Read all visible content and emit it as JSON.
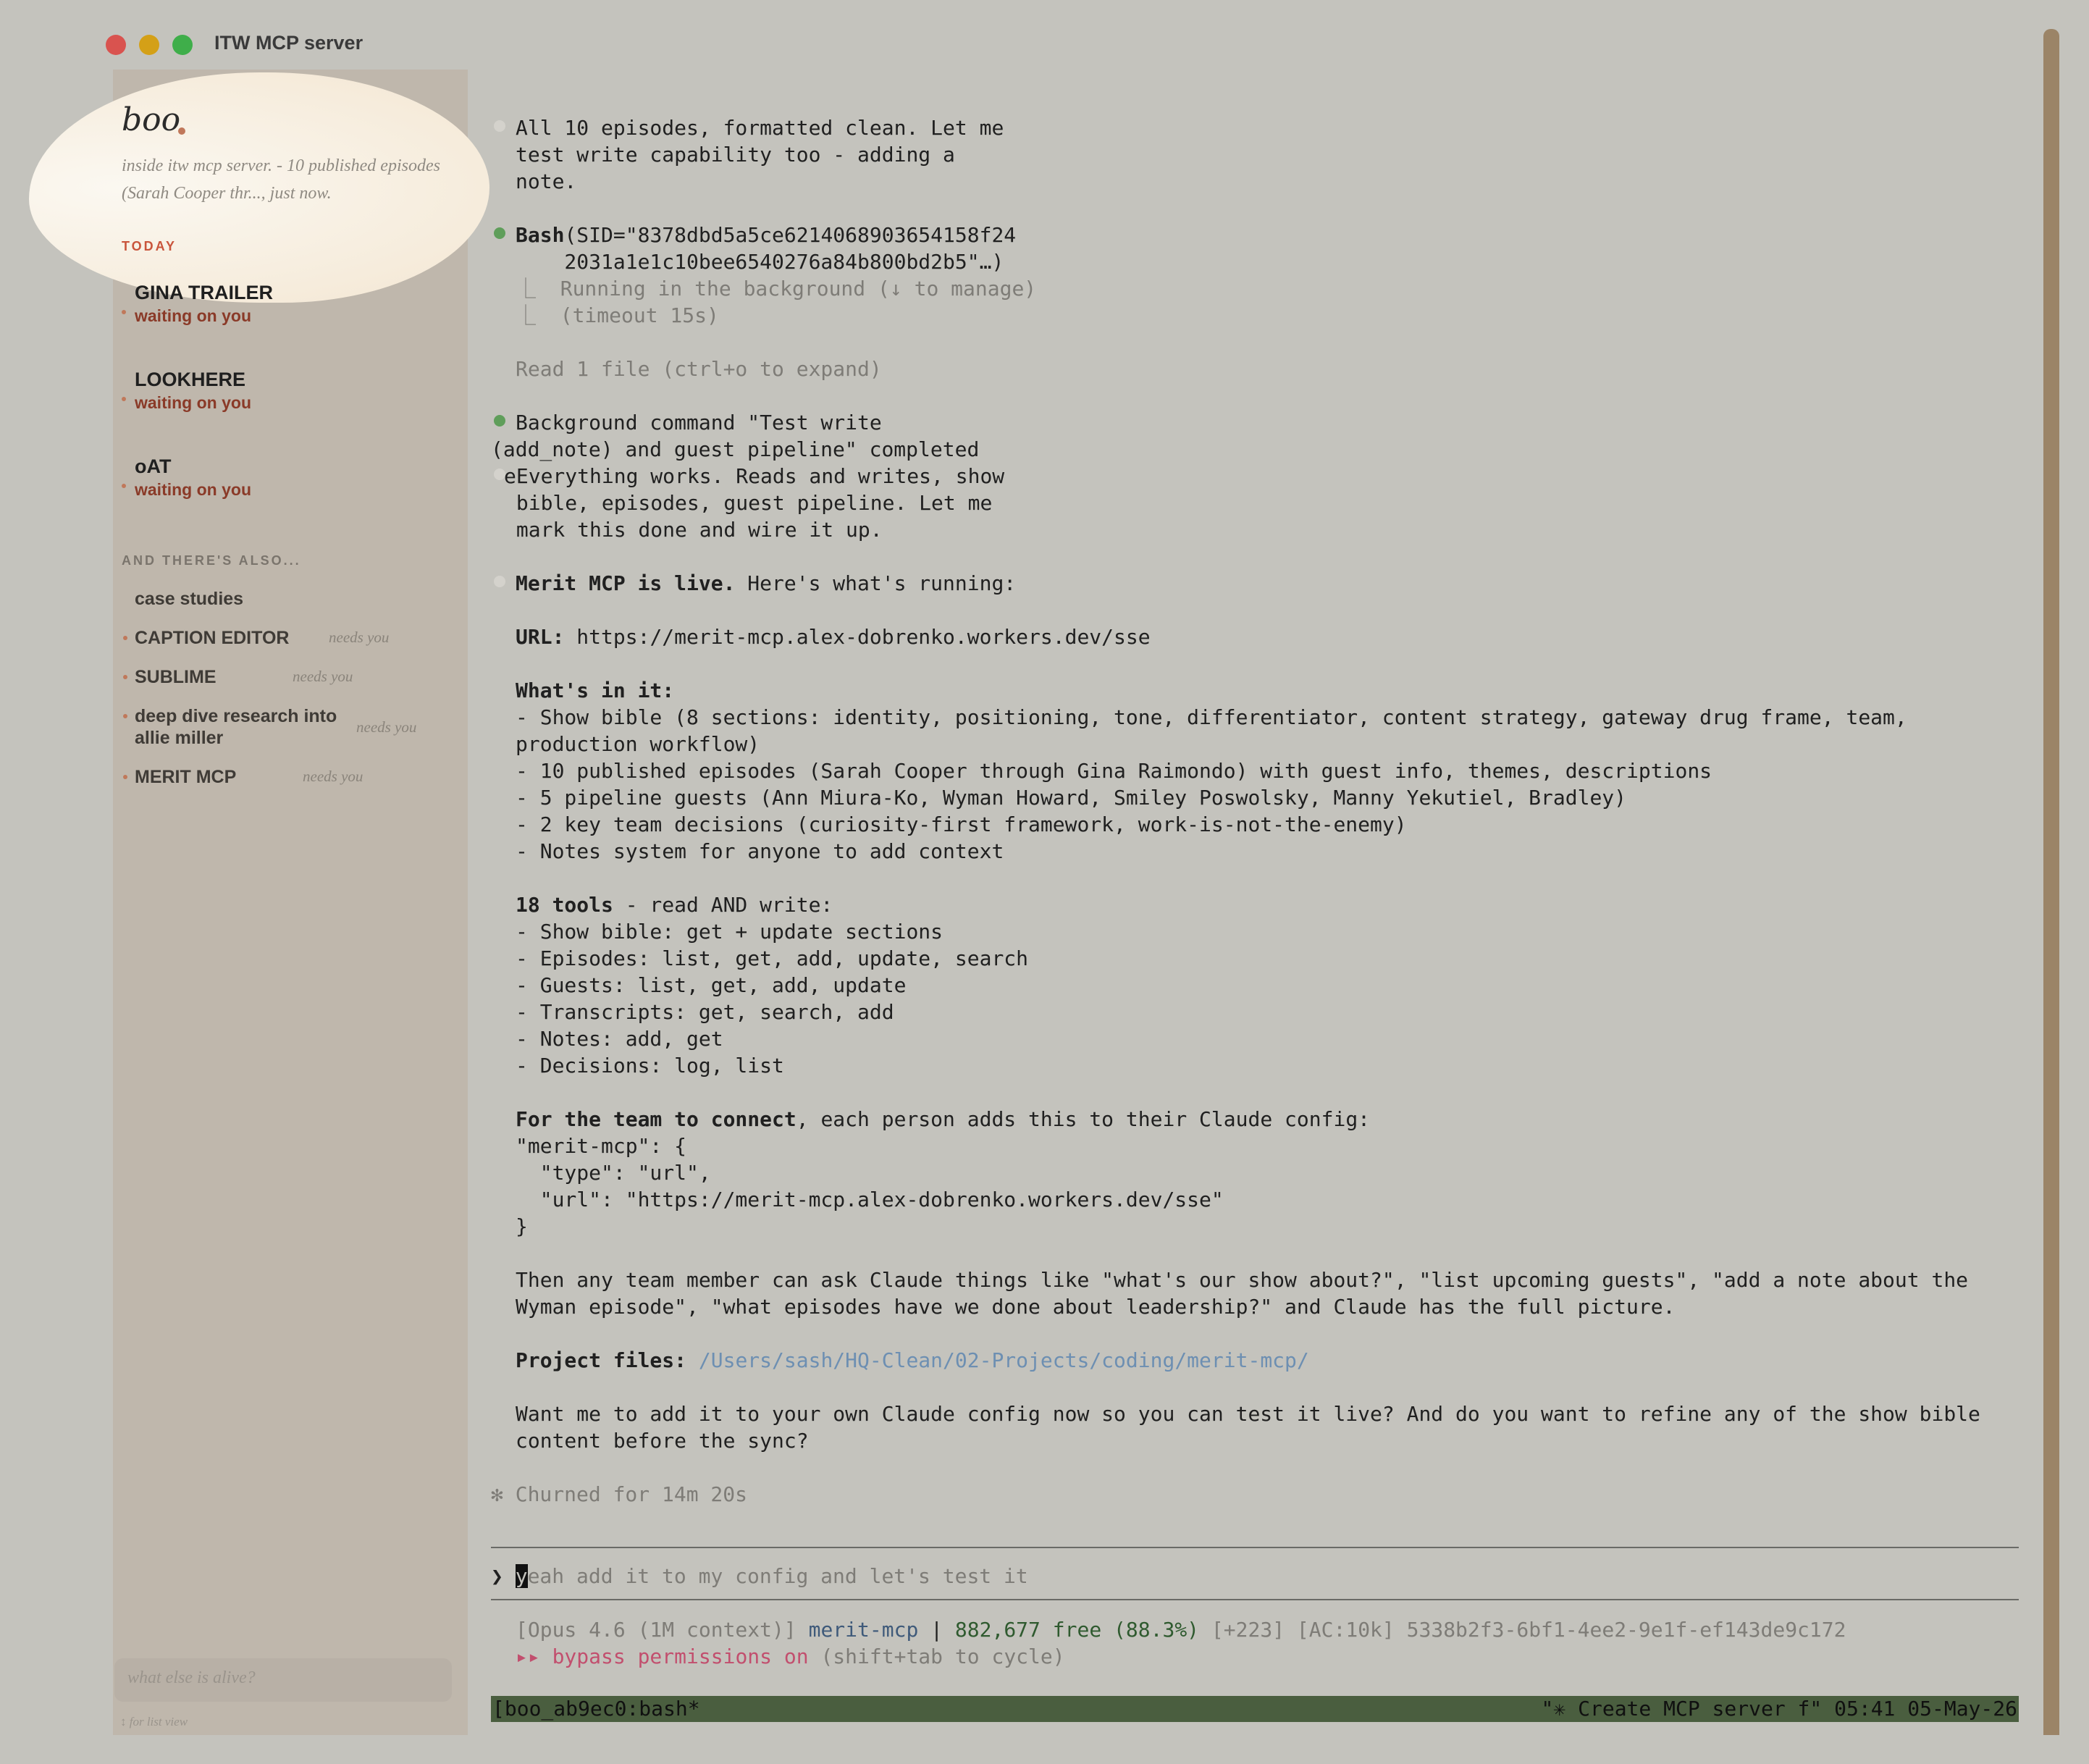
{
  "window": {
    "title": "ITW MCP server"
  },
  "sidebar": {
    "hero": {
      "title": "boo",
      "subtitle": "inside itw mcp server. - 10 published episodes (Sarah Cooper thr..., just now."
    },
    "today_label": "TODAY",
    "today": [
      {
        "name": "GINA TRAILER",
        "status": "waiting on you"
      },
      {
        "name": "LOOKHERE",
        "status": "waiting on you"
      },
      {
        "name": "oAT",
        "status": "waiting on you"
      }
    ],
    "also_label": "AND THERE'S ALSO...",
    "also": [
      {
        "name": "case studies",
        "needs": ""
      },
      {
        "name": "CAPTION EDITOR",
        "needs": "needs you"
      },
      {
        "name": "SUBLIME",
        "needs": "needs you"
      },
      {
        "name": "deep dive research into",
        "name2": "allie miller",
        "needs": "needs you"
      },
      {
        "name": "MERIT MCP",
        "needs": "needs you"
      }
    ],
    "ask_placeholder": "what else is alive?",
    "hint": "↕ for list view"
  },
  "terminal": {
    "intro": [
      "All 10 episodes, formatted clean. Let me",
      "test write capability too - adding a",
      "note."
    ],
    "bash_cmd_label": "Bash",
    "bash_cmd_1": "(SID=\"8378dbd5a5ce6214068903654158f24",
    "bash_cmd_2": "    2031a1e1c10bee6540276a84b800bd2b5\"…)",
    "bash_out_1": "⎿  Running in the background (↓ to manage)",
    "bash_out_2": "⎿  (timeout 15s)",
    "read_files": "Read 1 file (ctrl+o to expand)",
    "bg_1": "Background command \"Test write",
    "bg_2": "(add_note) and guest pipeline\" completed",
    "works": [
      "eEverything works. Reads and writes, show",
      " bible, episodes, guest pipeline. Let me",
      " mark this done and wire it up."
    ],
    "live_bold": "Merit MCP is live.",
    "live_rest": " Here's what's running:",
    "url_label": "URL:",
    "url_value": " https://merit-mcp.alex-dobrenko.workers.dev/sse",
    "whats_in": "What's in it:",
    "items": [
      "- Show bible (8 sections: identity, positioning, tone, differentiator, content strategy, gateway drug frame, team,",
      "production workflow)",
      "- 10 published episodes (Sarah Cooper through Gina Raimondo) with guest info, themes, descriptions",
      "- 5 pipeline guests (Ann Miura-Ko, Wyman Howard, Smiley Poswolsky, Manny Yekutiel, Bradley)",
      "- 2 key team decisions (curiosity-first framework, work-is-not-the-enemy)",
      "- Notes system for anyone to add context"
    ],
    "tools_bold": "18 tools",
    "tools_rest": " - read AND write:",
    "tools": [
      "- Show bible: get + update sections",
      "- Episodes: list, get, add, update, search",
      "- Guests: list, get, add, update",
      "- Transcripts: get, search, add",
      "- Notes: add, get",
      "- Decisions: log, list"
    ],
    "connect_bold": "For the team to connect",
    "connect_rest": ", each person adds this to their Claude config:",
    "config": [
      "\"merit-mcp\": {",
      "  \"type\": \"url\",",
      "  \"url\": \"https://merit-mcp.alex-dobrenko.workers.dev/sse\"",
      "}"
    ],
    "then": [
      "Then any team member can ask Claude things like \"what's our show about?\", \"list upcoming guests\", \"add a note about the",
      "Wyman episode\", \"what episodes have we done about leadership?\" and Claude has the full picture."
    ],
    "project_label": "Project files:",
    "project_path": "/Users/sash/HQ-Clean/02-Projects/coding/merit-mcp/",
    "want": [
      "Want me to add it to your own Claude config now so you can test it live? And do you want to refine any of the show bible",
      "content before the sync?"
    ],
    "churned": "✻ Churned for 14m 20s",
    "prompt_symbol": "❯",
    "prompt_cursor_char": "y",
    "prompt_text": "eah add it to my config and let's test it",
    "status_model": "[Opus 4.6 (1M context)]",
    "status_repo": "merit-mcp",
    "status_sep": " | ",
    "status_free": "882,677 free (88.3%)",
    "status_rest": " [+223] [AC:10k] 5338b2f3-6bf1-4ee2-9e1f-ef143de9c172",
    "bypass_arrows": "▸▸",
    "bypass_label": " bypass permissions on",
    "bypass_hint": " (shift+tab to cycle)",
    "tmux_left": "[boo_ab9ec0:bash*",
    "tmux_right": "\"✳ Create MCP server f\" 05:41 05-May-26"
  },
  "colors": {
    "background": "#c4c3bd",
    "sidebar": "#bfb7ac",
    "accent_red": "#c9553c",
    "status_green": "#5f9e5a",
    "tmux_bar": "#4a5e3f",
    "link": "#6d8fb2",
    "bypass_pink": "#c24f6e"
  }
}
